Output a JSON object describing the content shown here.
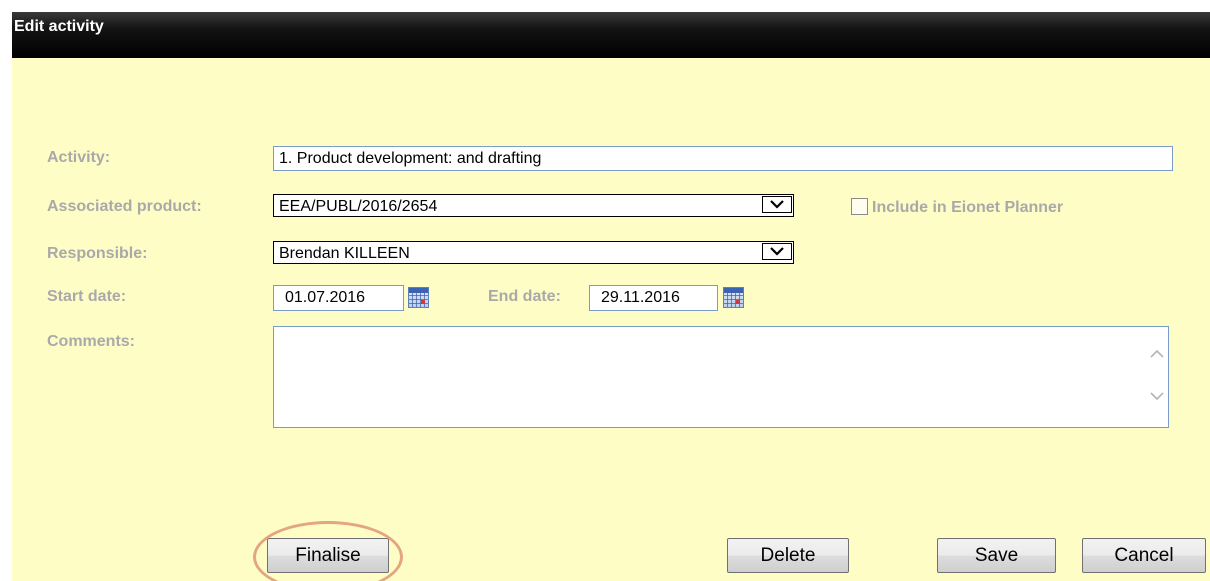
{
  "dialog": {
    "title": "Edit activity"
  },
  "form": {
    "activity_label": "Activity:",
    "activity_value": "1. Product development: and drafting",
    "product_label": "Associated product:",
    "product_value": "EEA/PUBL/2016/2654",
    "eionet_label": "Include in Eionet Planner",
    "eionet_checked": false,
    "responsible_label": "Responsible:",
    "responsible_value": "Brendan KILLEEN",
    "start_label": "Start date:",
    "start_value": "01.07.2016",
    "end_label": "End date:",
    "end_value": "29.11.2016",
    "comments_label": "Comments:",
    "comments_value": ""
  },
  "buttons": {
    "finalise": "Finalise",
    "delete": "Delete",
    "save": "Save",
    "cancel": "Cancel"
  },
  "colors": {
    "background": "#fffdc6",
    "label": "#a9a9a9",
    "highlight_ring": "#e4a57f"
  }
}
